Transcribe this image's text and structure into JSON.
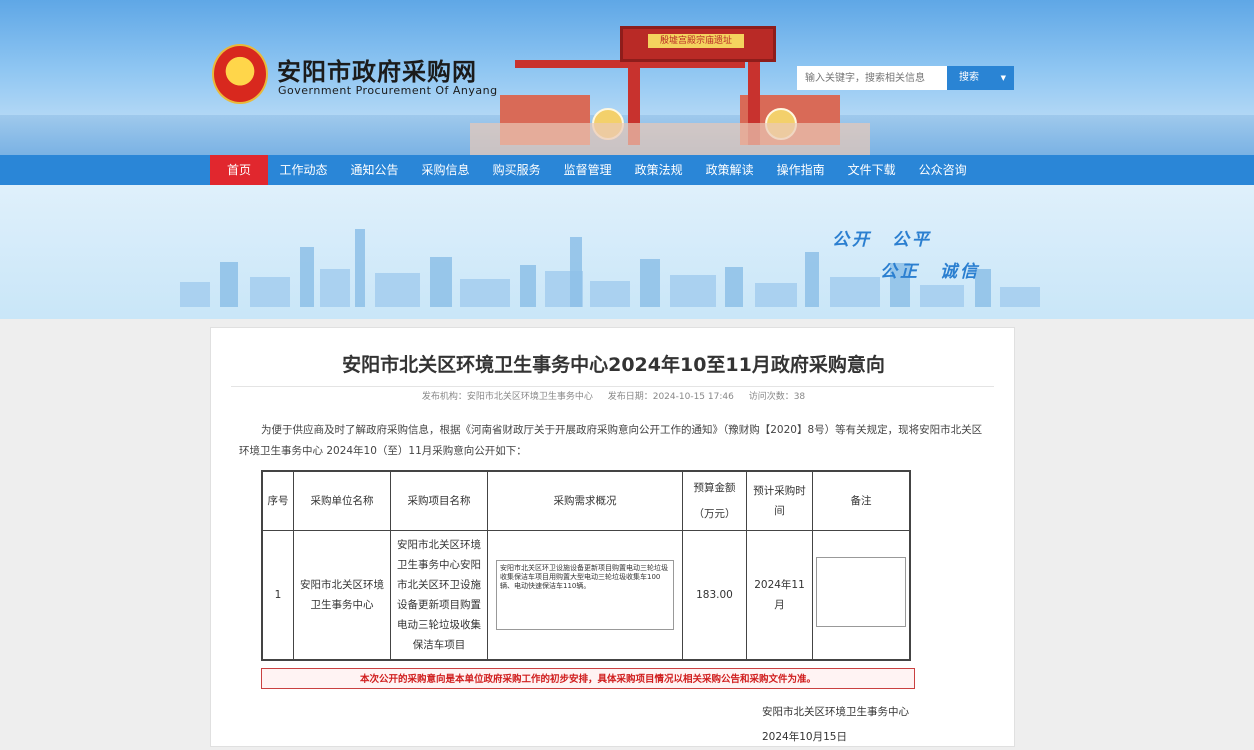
{
  "header": {
    "site_title": "安阳市政府采购网",
    "site_subtitle": "Government Procurement Of Anyang",
    "gate_sign": "殷墟宫殿宗庙遗址",
    "search_placeholder": "输入关键字，搜索相关信息",
    "search_button": "搜索"
  },
  "nav": {
    "items": [
      "首页",
      "工作动态",
      "通知公告",
      "采购信息",
      "购买服务",
      "监督管理",
      "政策法规",
      "政策解读",
      "操作指南",
      "文件下载",
      "公众咨询"
    ]
  },
  "banner": {
    "slogan_1": "公开　公平",
    "slogan_2": "公正　诚信"
  },
  "article": {
    "title": "安阳市北关区环境卫生事务中心2024年10至11月政府采购意向",
    "meta": {
      "publisher": "发布机构：安阳市北关区环境卫生事务中心",
      "date": "发布日期：2024-10-15 17:46",
      "visits": "访问次数：38"
    },
    "intro": "为便于供应商及时了解政府采购信息，根据《河南省财政厅关于开展政府采购意向公开工作的通知》（豫财购【2020】8号）等有关规定，现将安阳市北关区环境卫生事务中心 2024年10（至）11月采购意向公开如下：",
    "table": {
      "headers": {
        "seq": "序号",
        "unit": "采购单位名称",
        "project": "采购项目名称",
        "summary": "采购需求概况",
        "budget_l1": "预算金额",
        "budget_l2": "（万元）",
        "time_l1": "预计采购时",
        "time_l2": "间",
        "remark": "备注"
      },
      "row": {
        "seq": "1",
        "unit_l1": "安阳市北关区环境",
        "unit_l2": "卫生事务中心",
        "project_lines": [
          "安阳市北关区环境",
          "卫生事务中心安阳",
          "市北关区环卫设施",
          "设备更新项目购置",
          "电动三轮垃圾收集",
          "保洁车项目"
        ],
        "summary": "安阳市北关区环卫设施设备更新项目购置电动三轮垃圾收集保洁车项目用购置大型电动三轮垃圾收集车100辆、电动快速保洁车110辆。",
        "budget": "183.00",
        "time": "2024年11月",
        "remark": ""
      }
    },
    "notice": "本次公开的采购意向是本单位政府采购工作的初步安排，具体采购项目情况以相关采购公告和采购文件为准。",
    "signature_org": "安阳市北关区环境卫生事务中心",
    "signature_date": "2024年10月15日"
  }
}
